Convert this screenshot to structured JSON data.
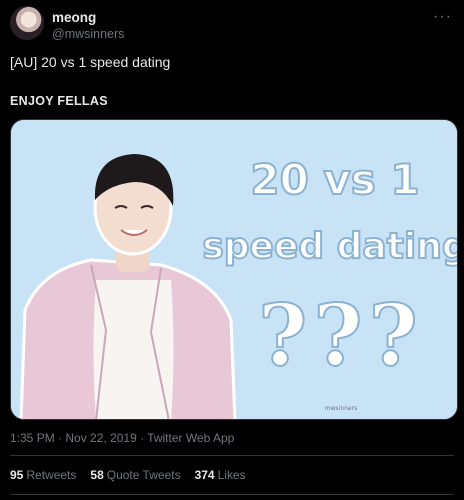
{
  "user": {
    "name": "meong",
    "handle": "@mwsinners"
  },
  "menu": {
    "more_icon": "more-dots-icon"
  },
  "tweet": {
    "line1": "[AU] 20 vs 1 speed dating",
    "line2": "ENJOY FELLAS"
  },
  "media": {
    "title_line1": "20 vs 1",
    "title_line2": "speed dating",
    "question": "???",
    "watermark": "mwsinners",
    "bg_color": "#c9e3f6"
  },
  "meta": {
    "text": "1:35 PM · Nov 22, 2019 · Twitter Web App"
  },
  "stats": {
    "retweets_count": "95",
    "retweets_label": "Retweets",
    "quotes_count": "58",
    "quotes_label": "Quote Tweets",
    "likes_count": "374",
    "likes_label": "Likes"
  }
}
